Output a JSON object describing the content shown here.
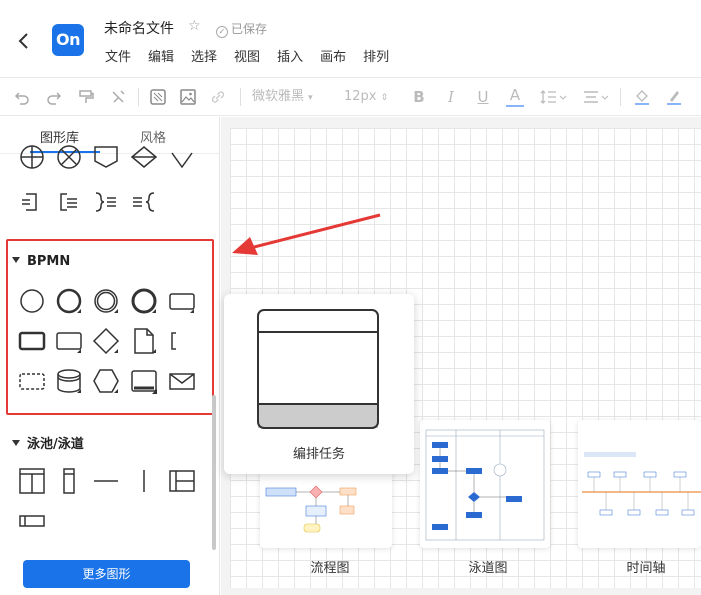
{
  "header": {
    "logo_text": "On",
    "file_name": "未命名文件",
    "save_status": "已保存",
    "menu": [
      "文件",
      "编辑",
      "选择",
      "视图",
      "插入",
      "画布",
      "排列"
    ]
  },
  "toolbar": {
    "font_family": "微软雅黑",
    "font_size": "12px",
    "bold": "B",
    "italic": "I",
    "underline": "U",
    "font_color": "A"
  },
  "sidebar": {
    "tabs": [
      "图形库",
      "风格"
    ],
    "sections": {
      "bpmn": "BPMN",
      "pool": "泳池/泳道"
    },
    "more_button": "更多图形"
  },
  "preview": {
    "label": "编排任务"
  },
  "templates": [
    {
      "label": "流程图"
    },
    {
      "label": "泳道图"
    },
    {
      "label": "时间轴"
    }
  ],
  "colors": {
    "accent": "#1a73e8",
    "highlight": "#e53935"
  }
}
